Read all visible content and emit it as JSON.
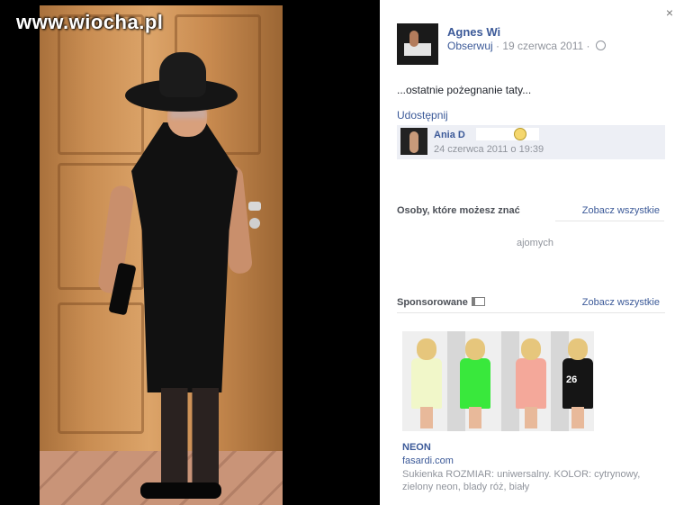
{
  "watermark": {
    "text": "www.wiocha.pl"
  },
  "post": {
    "author": "Agnes Wi",
    "follow": "Obserwuj",
    "date": "· 19 czerwca 2011 ·",
    "text": "...ostatnie pożegnanie taty...",
    "share": "Udostępnij"
  },
  "comment": {
    "name": "Ania D",
    "date": "24 czerwca 2011 o 19:39"
  },
  "people": {
    "title": "Osoby, które możesz znać",
    "see_all": "Zobacz wszystkie",
    "text": "ajomych"
  },
  "sponsored": {
    "title": "Sponsorowane",
    "see_all": "Zobacz wszystkie",
    "ad_title": "NEON",
    "ad_domain": "fasardi.com",
    "ad_desc": "Sukienka ROZMIAR: uniwersalny. KOLOR: cytrynowy, zielony neon, blady róż, biały",
    "dress_colors": [
      "#f1f7c9",
      "#39e83c",
      "#f4a89a",
      "#151515"
    ],
    "dress_number": "26"
  },
  "close": {
    "label": "×"
  }
}
